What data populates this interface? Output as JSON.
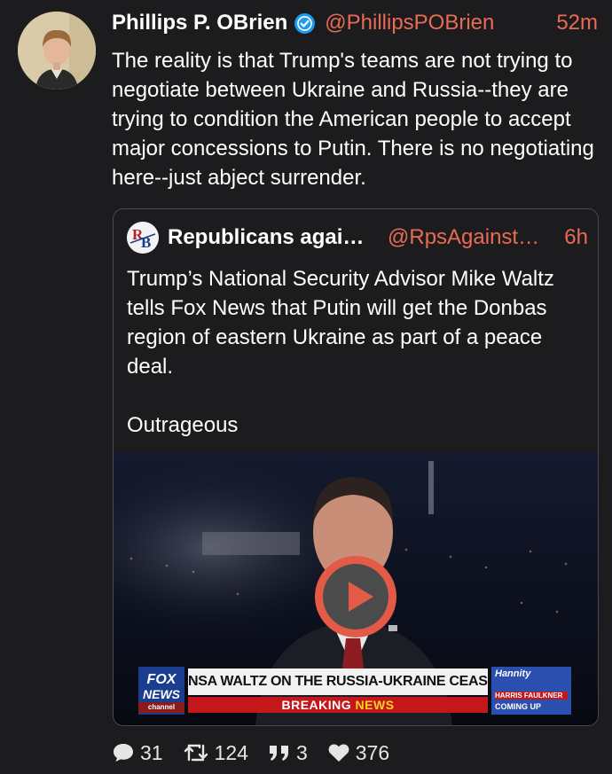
{
  "tweet": {
    "author_name": "Phillips P. OBrien",
    "author_handle": "@PhillipsPOBrien",
    "time": "52m",
    "text": "The reality is that Trump's teams are not trying to negotiate between Ukraine and Russia--they are trying to condition the American people to accept major concessions to Putin. There is no negotiating here--just abject surrender."
  },
  "quote": {
    "author_name": "Republicans agai…",
    "author_handle": "@RpsAgainst…",
    "time": "6h",
    "text": "Trump’s National Security Advisor Mike Waltz tells Fox News that Putin will get the Donbas region of eastern Ukraine as part of a peace deal.\n\nOutrageous",
    "video": {
      "logo_line1": "FOX",
      "logo_line2": "NEWS",
      "logo_line3": "channel",
      "banner": "NSA WALTZ ON THE RUSSIA-UKRAINE CEASEFIRE TALKS",
      "breaking_word1": "BREAKING",
      "breaking_word2": "NEWS",
      "promo_brand": "Hannity",
      "promo_name": "HARRIS FAULKNER",
      "promo_status": "COMING UP"
    }
  },
  "actions": {
    "replies": "31",
    "retweets": "124",
    "quotes": "3",
    "likes": "376"
  },
  "colors": {
    "background": "#1c1c1e",
    "accent": "#ea6a55",
    "verified": "#1d9bf0"
  },
  "icons": {
    "verified": "verified-badge-icon",
    "play": "play-icon",
    "reply": "speech-bubble-icon",
    "retweet": "retweet-icon",
    "quote": "quote-icon",
    "like": "heart-icon"
  }
}
